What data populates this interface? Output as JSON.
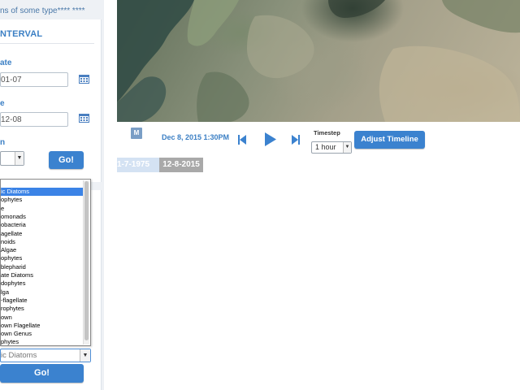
{
  "sidebar": {
    "type_note": "ns of some type**** ****",
    "interval": {
      "title": "NTERVAL",
      "start_label": "ate",
      "start_value": "01-07",
      "end_label": "e",
      "end_value": "12-08",
      "period_label": "n",
      "go_label": "Go!"
    },
    "species": {
      "options": [
        "ic Diatoms",
        "ophytes",
        "e",
        "omonads",
        "obacteria",
        "agellate",
        "noids",
        "Algae",
        "ophytes",
        "blepharid",
        "ate Diatoms",
        "dophytes",
        "lga",
        "-flagellate",
        "rophytes",
        "own",
        "own Flagellate",
        "own Genus",
        "phytes"
      ],
      "selected_index": 0,
      "selected_value": "ic Diatoms",
      "go_label": "Go!"
    }
  },
  "timeline": {
    "m_badge": "M",
    "current_date": "Dec 8, 2015 1:30PM",
    "timestep_label": "Timestep",
    "timestep_value": "1 hour",
    "adjust_label": "Adjust Timeline",
    "range_start": "1-7-1975",
    "range_end": "12-8-2015"
  },
  "colors": {
    "accent": "#3b82cf",
    "label_blue": "#3b7fc4",
    "selected_option": "#3b83e6",
    "range_end_bg": "#a9a9a9"
  }
}
